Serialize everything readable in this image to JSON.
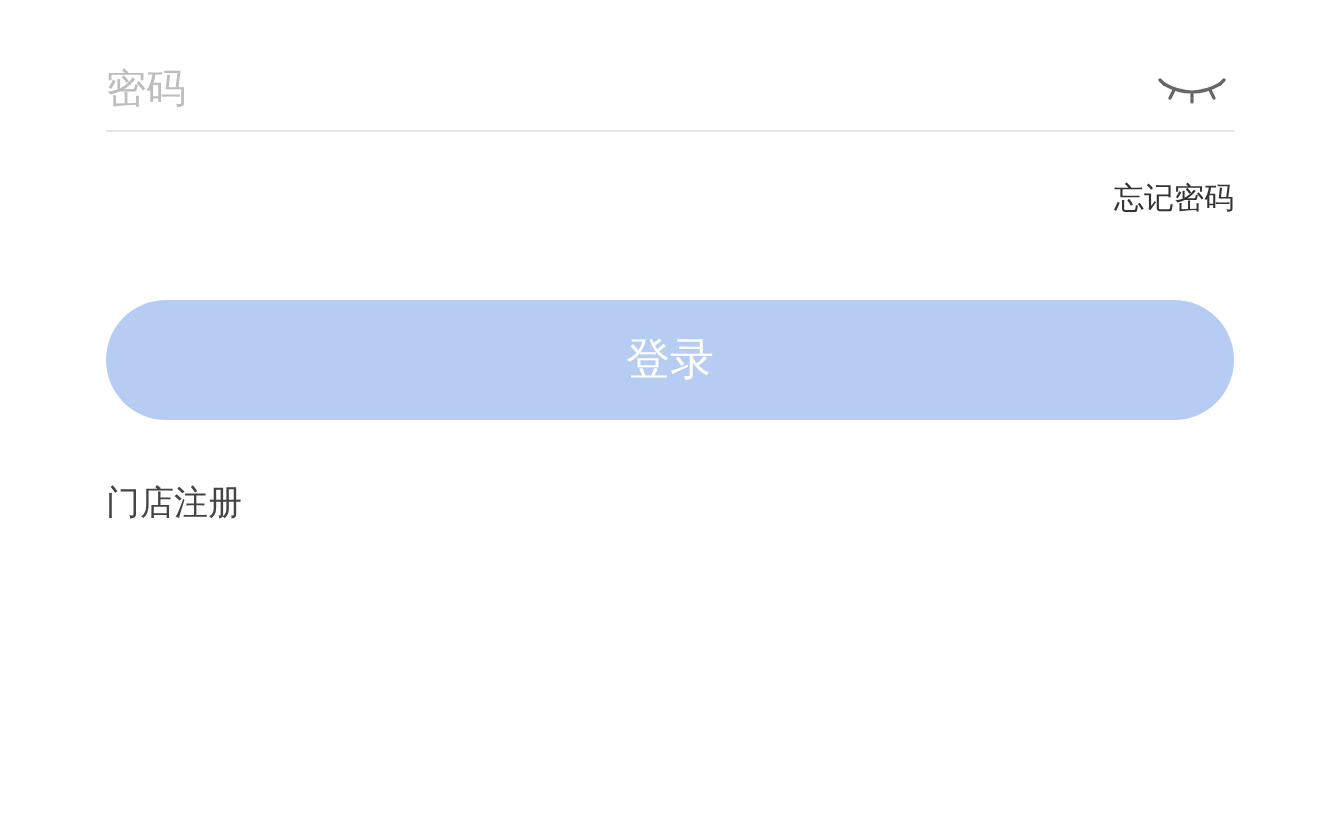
{
  "password_field": {
    "placeholder": "密码",
    "visible": false
  },
  "forgot_password": "忘记密码",
  "login_button": {
    "label": "登录",
    "disabled": true
  },
  "register_link": "门店注册"
}
